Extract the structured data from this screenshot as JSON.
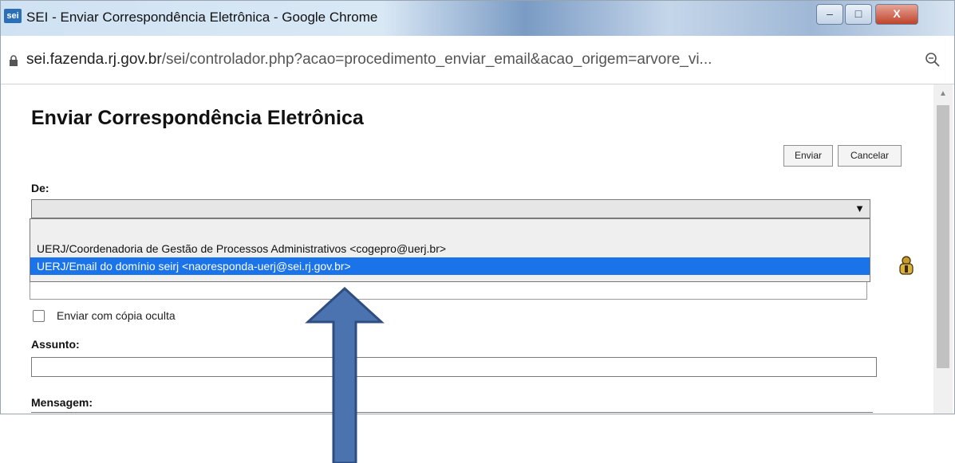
{
  "window": {
    "app_icon": "sei",
    "title": "SEI - Enviar Correspondência Eletrônica - Google Chrome",
    "controls": {
      "minimize": "–",
      "maximize": "□",
      "close": "X"
    }
  },
  "address_bar": {
    "url_domain": "sei.fazenda.rj.gov.br",
    "url_path": "/sei/controlador.php?acao=procedimento_enviar_email&acao_origem=arvore_vi..."
  },
  "page": {
    "title": "Enviar Correspondência Eletrônica",
    "buttons": {
      "enviar": "Enviar",
      "cancelar": "Cancelar"
    },
    "de_label": "De:",
    "de_options": [
      "UERJ/Coordenadoria de Gestão de Processos Administrativos <cogepro@uerj.br>",
      "UERJ/Email do domínio seirj <naoresponda-uerj@sei.rj.gov.br>"
    ],
    "bcc_label": "Enviar com cópia oculta",
    "assunto_label": "Assunto:",
    "mensagem_label": "Mensagem:"
  },
  "colors": {
    "selected_option": "#1a73e8",
    "arrow_fill": "#4a73b0",
    "arrow_stroke": "#2f4e80"
  }
}
